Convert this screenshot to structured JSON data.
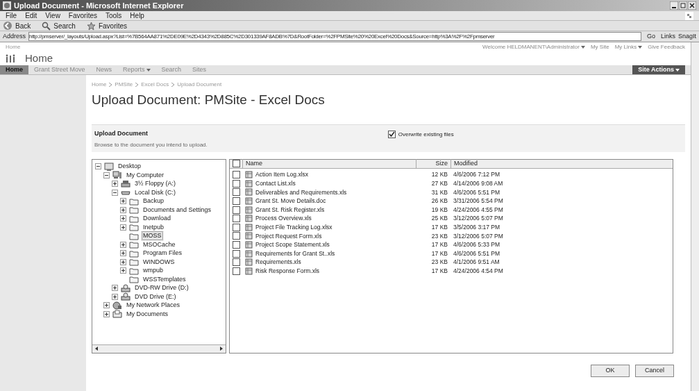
{
  "window": {
    "title": "Upload Document - Microsoft Internet Explorer"
  },
  "menu": [
    "File",
    "Edit",
    "View",
    "Favorites",
    "Tools",
    "Help"
  ],
  "toolbar": [
    {
      "kind": "back",
      "label": "Back"
    },
    {
      "kind": "search",
      "label": "Search"
    },
    {
      "kind": "favorites",
      "label": "Favorites"
    }
  ],
  "address": {
    "label": "Address",
    "value": "http://pmserver/_layouts/Upload.aspx?List=%7B564AA871%2DE09E%2D4343%2D885C%2D301339AF8ADB%7D&RootFolder=%2FPMSite%20%20Excel%20Docs&Source=http%3A%2F%2Fpmserver",
    "go": "Go",
    "links": "Links",
    "snagit": "SnagIt"
  },
  "site": {
    "top_link": "Home",
    "welcome": "Welcome HELDMANENT\\Administrator",
    "my_site": "My Site",
    "my_links": "My Links",
    "feedback": "Give Feedback",
    "title": "Home",
    "site_actions": "Site Actions"
  },
  "nav": [
    {
      "label": "Home",
      "selected": true
    },
    {
      "label": "Grant Street Move",
      "selected": false
    },
    {
      "label": "News",
      "selected": false
    },
    {
      "label": "Reports",
      "selected": false,
      "menu": true
    },
    {
      "label": "Search",
      "selected": false
    },
    {
      "label": "Sites",
      "selected": false
    }
  ],
  "breadcrumb": [
    "Home",
    "PMSite",
    "Excel Docs",
    "Upload Document"
  ],
  "page_title": "Upload Document: PMSite - Excel Docs",
  "section": {
    "heading": "Upload Document",
    "description": "Browse to the document you intend to upload.",
    "overwrite": {
      "label": "Overwrite existing files",
      "checked": true
    }
  },
  "tree": [
    {
      "label": "Desktop",
      "kind": "desktop",
      "expanded": true,
      "selected": false,
      "children": [
        {
          "label": "My Computer",
          "kind": "computer",
          "expanded": true,
          "selected": false,
          "children": [
            {
              "label": "3½ Floppy (A:)",
              "kind": "floppy",
              "expanded": false,
              "selected": false
            },
            {
              "label": "Local Disk (C:)",
              "kind": "disk",
              "expanded": true,
              "selected": false,
              "children": [
                {
                  "label": "Backup",
                  "kind": "folder",
                  "expanded": false,
                  "selected": false
                },
                {
                  "label": "Documents and Settings",
                  "kind": "folder",
                  "expanded": false,
                  "selected": false
                },
                {
                  "label": "Download",
                  "kind": "folder",
                  "expanded": false,
                  "selected": false
                },
                {
                  "label": "Inetpub",
                  "kind": "folder",
                  "expanded": false,
                  "selected": false
                },
                {
                  "label": "MOSS",
                  "kind": "folder",
                  "selected": true
                },
                {
                  "label": "MSOCache",
                  "kind": "folder",
                  "expanded": false,
                  "selected": false
                },
                {
                  "label": "Program Files",
                  "kind": "folder",
                  "expanded": false,
                  "selected": false
                },
                {
                  "label": "WINDOWS",
                  "kind": "folder",
                  "expanded": false,
                  "selected": false
                },
                {
                  "label": "wmpub",
                  "kind": "folder",
                  "expanded": false,
                  "selected": false
                },
                {
                  "label": "WSSTemplates",
                  "kind": "folder",
                  "selected": false
                }
              ]
            },
            {
              "label": "DVD-RW Drive (D:)",
              "kind": "dvd",
              "expanded": false,
              "selected": false
            },
            {
              "label": "DVD Drive (E:)",
              "kind": "dvd",
              "expanded": false,
              "selected": false
            }
          ]
        },
        {
          "label": "My Network Places",
          "kind": "network",
          "expanded": false,
          "selected": false
        },
        {
          "label": "My Documents",
          "kind": "documents",
          "expanded": false,
          "selected": false
        }
      ]
    }
  ],
  "files": {
    "columns": [
      "Name",
      "Size",
      "Modified"
    ],
    "all_checked": false,
    "rows": [
      {
        "name": "Action Item Log.xlsx",
        "size": "12 KB",
        "modified": "4/6/2006 7:12 PM",
        "checked": false
      },
      {
        "name": "Contact List.xls",
        "size": "27 KB",
        "modified": "4/14/2006 9:08 AM",
        "checked": false
      },
      {
        "name": "Deliverables and Requirements.xls",
        "size": "31 KB",
        "modified": "4/6/2006 5:51 PM",
        "checked": false
      },
      {
        "name": "Grant St. Move Details.doc",
        "size": "26 KB",
        "modified": "3/31/2006 5:54 PM",
        "checked": false
      },
      {
        "name": "Grant St. Risk Register.xls",
        "size": "19 KB",
        "modified": "4/24/2006 4:55 PM",
        "checked": false
      },
      {
        "name": "Process Overview.xls",
        "size": "25 KB",
        "modified": "3/12/2006 5:07 PM",
        "checked": false
      },
      {
        "name": "Project File Tracking Log.xlsx",
        "size": "17 KB",
        "modified": "3/5/2006 3:17 PM",
        "checked": false
      },
      {
        "name": "Project Request Form.xls",
        "size": "23 KB",
        "modified": "3/12/2006 5:07 PM",
        "checked": false
      },
      {
        "name": "Project Scope Statement.xls",
        "size": "17 KB",
        "modified": "4/6/2006 5:33 PM",
        "checked": false
      },
      {
        "name": "Requirements for Grant St..xls",
        "size": "17 KB",
        "modified": "4/6/2006 5:51 PM",
        "checked": false
      },
      {
        "name": "Requirements.xls",
        "size": "23 KB",
        "modified": "4/1/2006 9:51 AM",
        "checked": false
      },
      {
        "name": "Risk Response Form.xls",
        "size": "17 KB",
        "modified": "4/24/2006 4:54 PM",
        "checked": false
      }
    ]
  },
  "buttons": [
    "OK",
    "Cancel"
  ]
}
